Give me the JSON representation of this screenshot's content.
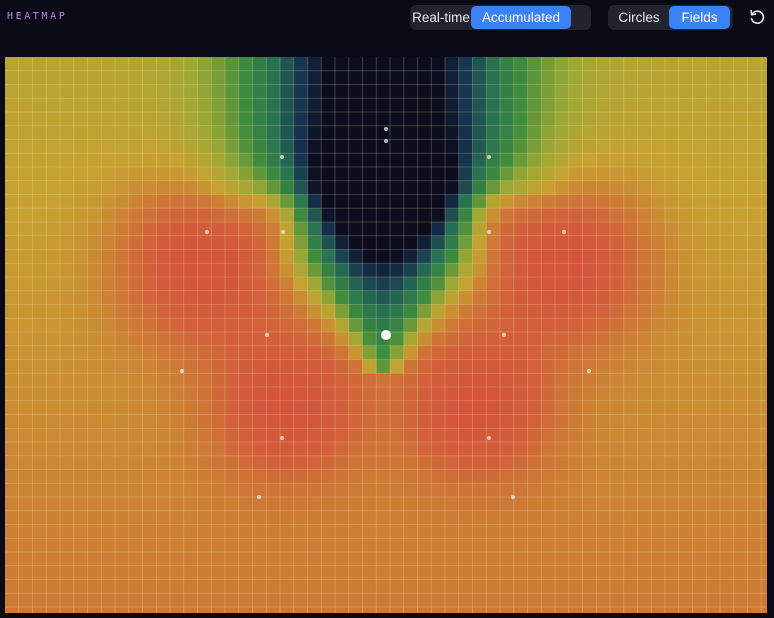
{
  "app": {
    "title": "HEATMAP"
  },
  "mode_toggle": {
    "options": [
      "Real-time",
      "Accumulated"
    ],
    "selected": "Accumulated"
  },
  "view_toggle": {
    "options": [
      "Circles",
      "Fields"
    ],
    "selected": "Fields"
  },
  "reset": {
    "icon": "reset-icon"
  },
  "colors": {
    "background": "#0a0a16",
    "accent": "#3b82f6",
    "title": "#c184e8",
    "field_high": "#d35a3c",
    "field_mid": "#c8a236",
    "field_low": "#3e8c3c",
    "field_min": "#0b0c1c"
  }
}
